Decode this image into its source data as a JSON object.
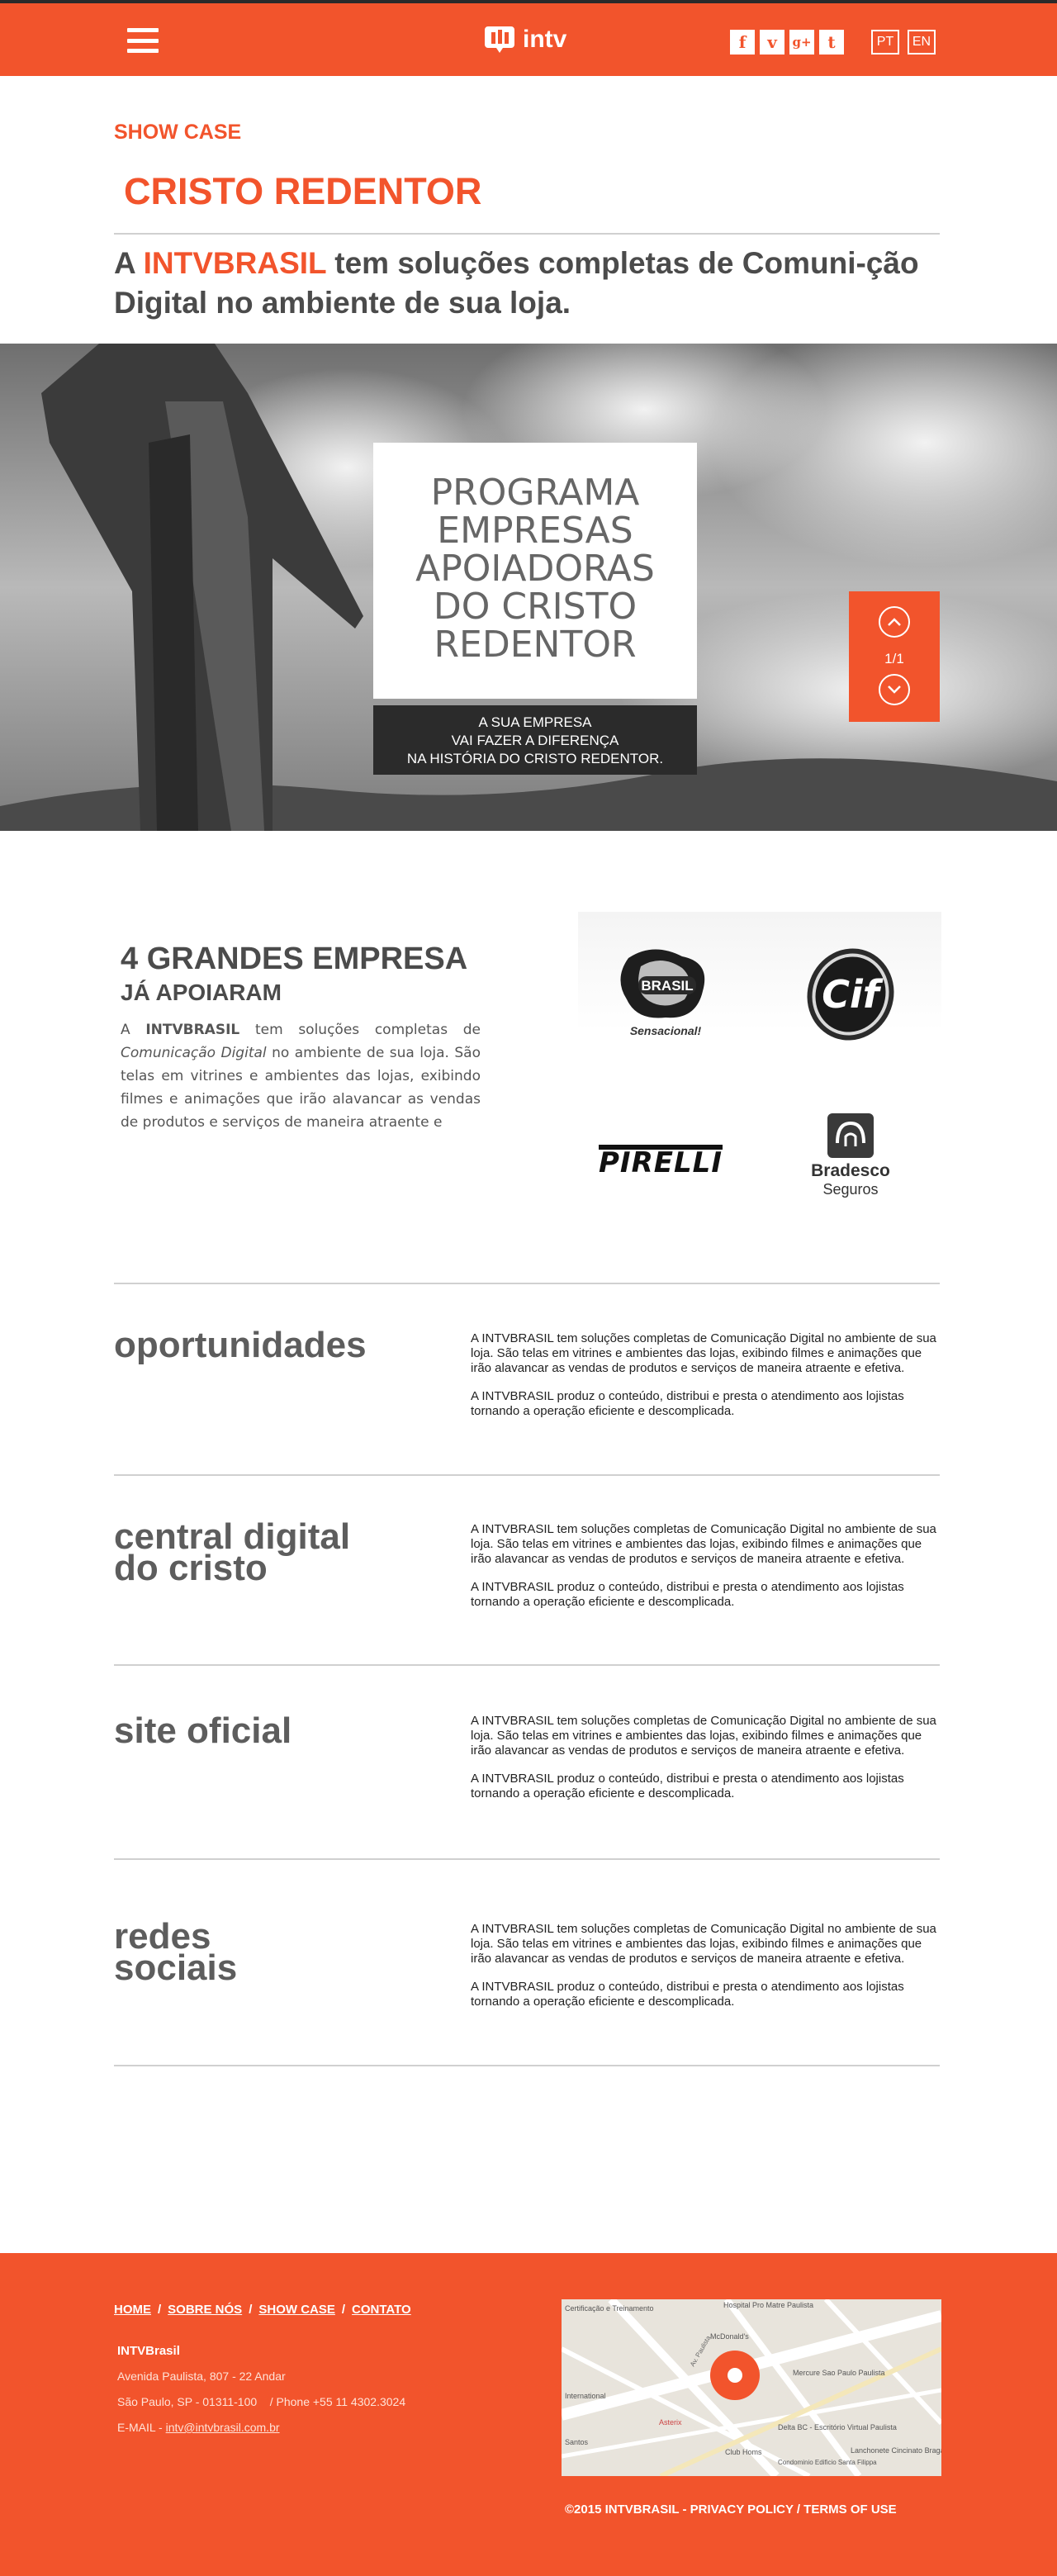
{
  "header": {
    "logo_text": "intv",
    "socials": [
      "f",
      "v",
      "g+",
      "t"
    ],
    "langs": [
      "PT",
      "EN"
    ]
  },
  "intro": {
    "kicker": "SHOW CASE",
    "title": "CRISTO REDENTOR",
    "lead_prefix": "A ",
    "lead_brand": "INTVBRASIL",
    "lead_rest": " tem soluções completas de Comuni-ção Digital no ambiente de sua loja."
  },
  "hero": {
    "card_lines": [
      "PROGRAMA",
      "EMPRESAS",
      "APOIADORAS",
      "DO CRISTO",
      "REDENTOR"
    ],
    "band_lines": [
      "A SUA EMPRESA",
      "VAI FAZER A DIFERENÇA",
      "NA HISTÓRIA DO CRISTO REDENTOR."
    ],
    "counter": "1/1"
  },
  "sponsors": {
    "title": "4 GRANDES EMPRESA",
    "subtitle": "JÁ APOIARAM",
    "text_a": "A ",
    "text_brand": "INTVBRASIL",
    "text_b": " tem soluções completas de ",
    "text_em": "Comunicação Digital",
    "text_c": " no ambiente de sua loja. São telas em vitrines e ambientes das lojas, exibindo filmes e animações que irão alavancar as vendas de produtos e serviços de maneira atraente e",
    "brands": {
      "brasil": "BRASIL",
      "brasil_tag": "Sensacional!",
      "cif": "Cif",
      "pirelli": "PIRELLI",
      "bradesco": "Bradesco",
      "bradesco_sub": "Seguros"
    }
  },
  "sections": [
    {
      "title": "oportunidades",
      "p1": "A INTVBRASIL tem soluções completas de Comunicação Digital no ambiente de sua loja. São telas em vitrines e ambientes das lojas, exibindo filmes e animações que irão alavancar as vendas de produtos e serviços de maneira atraente e efetiva.",
      "p2": "A INTVBRASIL produz o conteúdo, distribui e presta o atendimento aos lojistas tornando a operação eficiente e descomplicada."
    },
    {
      "title": "central digital do cristo",
      "p1": "A INTVBRASIL tem soluções completas de Comunicação Digital no ambiente de sua loja. São telas em vitrines e ambientes das lojas, exibindo filmes e animações que irão alavancar as vendas de produtos e serviços de maneira atraente e efetiva.",
      "p2": "A INTVBRASIL produz o conteúdo, distribui e presta o atendimento aos lojistas tornando a operação eficiente e descomplicada."
    },
    {
      "title": "site oficial",
      "p1": "A INTVBRASIL tem soluções completas de Comunicação Digital no ambiente de sua loja. São telas em vitrines e ambientes das lojas, exibindo filmes e animações que irão alavancar as vendas de produtos e serviços de maneira atraente e efetiva.",
      "p2": "A INTVBRASIL produz o conteúdo, distribui e presta o atendimento aos lojistas tornando a operação eficiente e descomplicada."
    },
    {
      "title": "redes sociais",
      "p1": "A INTVBRASIL tem soluções completas de Comunicação Digital no ambiente de sua loja. São telas em vitrines e ambientes das lojas, exibindo filmes e animações que irão alavancar as vendas de produtos e serviços de maneira atraente e efetiva.",
      "p2": "A INTVBRASIL produz o conteúdo, distribui e presta o atendimento aos lojistas tornando a operação eficiente e descomplicada."
    }
  ],
  "footer": {
    "nav": [
      "HOME",
      "SOBRE NÓS",
      "SHOW CASE",
      "CONTATO"
    ],
    "company": "INTVBrasil",
    "address1": "Avenida Paulista, 807 - 22 Andar",
    "address2": "São Paulo, SP - 01311-100    / Phone +55 11 4302.3024",
    "email_label": "E-MAIL - ",
    "email": "intv@intvbrasil.com.br",
    "copyright": "©2015 INTVBRASIL  - PRIVACY POLICY / TERMS OF USE",
    "map_labels": [
      "Hospital Pro Matre Paulista",
      "McDonald's",
      "Mercure Sao Paulo Paulista",
      "Delta BC - Escritório Virtual Paulista",
      "Club Homs",
      "Condominio Edificio Santa Filippa",
      "Lanchonete Cincinato Braga",
      "Asterix",
      "Certificação e Treinamento",
      "International",
      "Santos",
      "Av. Paulista"
    ]
  }
}
